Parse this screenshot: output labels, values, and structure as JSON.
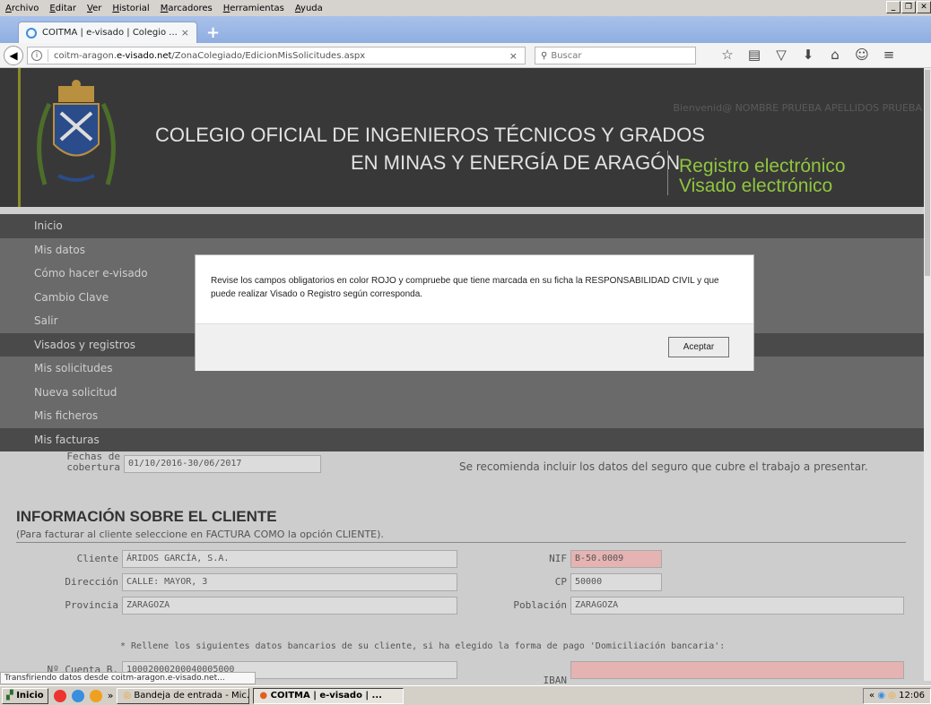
{
  "menu": [
    "Archivo",
    "Editar",
    "Ver",
    "Historial",
    "Marcadores",
    "Herramientas",
    "Ayuda"
  ],
  "tab": {
    "title": "COITMA | e-visado | Colegio ...",
    "close": "×",
    "new": "+"
  },
  "url": {
    "prefix": "coitm-aragon.",
    "host": "e-visado.net",
    "path": "/ZonaColegiado/EdicionMisSolicitudes.aspx",
    "clear": "×"
  },
  "search": {
    "placeholder": "Buscar"
  },
  "header": {
    "welcome": "Bienvenid@ NOMBRE PRUEBA APELLIDOS PRUEBA",
    "title_line1": "COLEGIO OFICIAL DE INGENIEROS TÉCNICOS Y GRADOS",
    "title_line2": "EN MINAS Y ENERGÍA DE ARAGÓN",
    "sub1": "Registro electrónico",
    "sub2": "Visado electrónico"
  },
  "sidemenu": [
    "Inicio",
    "Mis datos",
    "Cómo hacer e-visado",
    "Cambio Clave",
    "Salir",
    "Visados y registros",
    "Mis solicitudes",
    "Nueva solicitud",
    "Mis ficheros",
    "Mis facturas"
  ],
  "coverage": {
    "label1": "Fechas de",
    "label2": "cobertura",
    "value": "01/10/2016-30/06/2017",
    "recommend": "Se recomienda incluir los datos del seguro que cubre el trabajo a presentar."
  },
  "client": {
    "title": "INFORMACIÓN SOBRE EL CLIENTE",
    "subtitle": "(Para facturar al cliente seleccione en FACTURA COMO la opción CLIENTE).",
    "cliente_label": "Cliente",
    "cliente_value": "ÁRIDOS GARCÍA, S.A.",
    "nif_label": "NIF",
    "nif_value": "B-50.0009",
    "direccion_label": "Dirección",
    "direccion_value": "CALLE: MAYOR, 3",
    "cp_label": "CP",
    "cp_value": "50000",
    "provincia_label": "Provincia",
    "provincia_value": "ZARAGOZA",
    "poblacion_label": "Población",
    "poblacion_value": "ZARAGOZA",
    "note": "* Rellene los siguientes datos bancarios de su cliente, si ha elegido la forma de pago 'Domiciliación bancaria':",
    "cuenta_label": "Nº Cuenta B.",
    "cuenta_value": "10002000200040005000",
    "iban_label": "IBAN",
    "iban_value": ""
  },
  "dialog": {
    "message": "Revise los campos obligatorios en color ROJO y compruebe que tiene marcada en su ficha la RESPONSABILIDAD CIVIL y que puede realizar Visado o Registro según corresponda.",
    "ok": "Aceptar"
  },
  "status": "Transfiriendo datos desde coitm-aragon.e-visado.net...",
  "taskbar": {
    "start": "Inicio",
    "chevron": "»",
    "task1": "Bandeja de entrada - Mic...",
    "task2": "COITMA | e-visado | ...",
    "tray_chevron": "«",
    "clock": "12:06"
  },
  "colors": {
    "header_bg": "#383838",
    "accent_green": "#8fc63f",
    "required_red": "#e6b3b3"
  }
}
